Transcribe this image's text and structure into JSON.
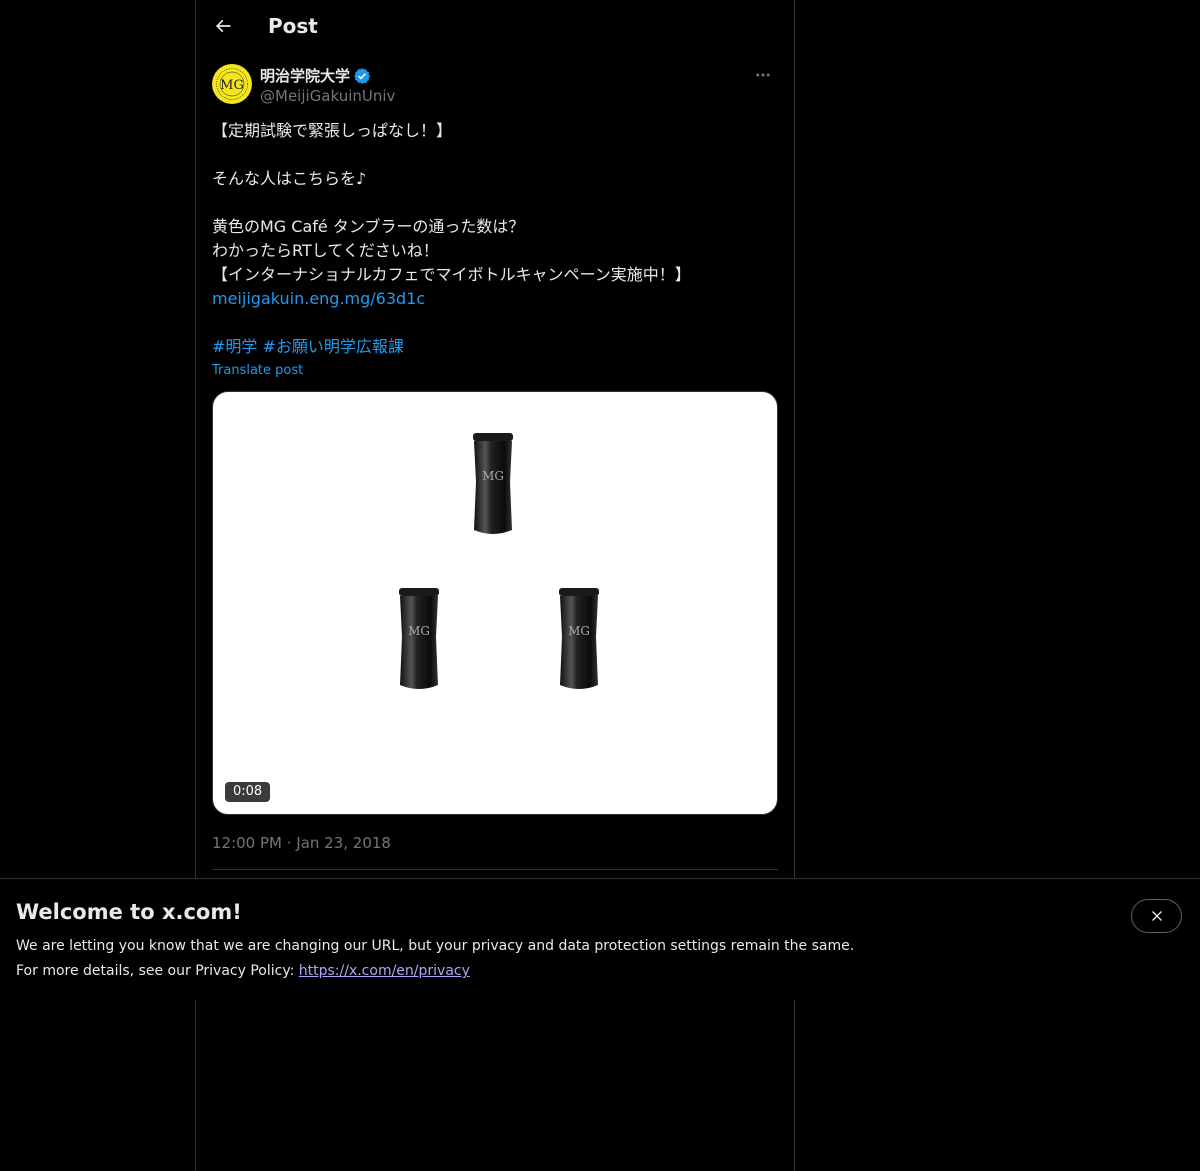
{
  "header": {
    "title": "Post"
  },
  "post": {
    "author": {
      "display_name": "明治学院大学",
      "handle": "@MeijiGakuinUniv",
      "avatar_initials": "MG",
      "verified": true
    },
    "text_lines": [
      "【定期試験で緊張しっぱなし！】",
      "",
      "そんな人はこちらを♪",
      "",
      "黄色のMG Café タンブラーの通った数は？",
      "わかったらRTしてくださいね！",
      "【インターナショナルカフェでマイボトルキャンペーン実施中！】"
    ],
    "link": "meijigakuin.eng.mg/63d1c",
    "hashtags": "#明学 #お願い明学広報課",
    "translate_label": "Translate post",
    "media": {
      "duration": "0:08",
      "tumbler_count": 3
    },
    "timestamp": "12:00 PM · Jan 23, 2018"
  },
  "banner": {
    "title": "Welcome to x.com!",
    "line1": "We are letting you know that we are changing our URL, but your privacy and data protection settings remain the same.",
    "line2_prefix": "For more details, see our Privacy Policy: ",
    "link": "https://x.com/en/privacy"
  },
  "colors": {
    "background": "#000000",
    "text": "#e7e9ea",
    "secondary_text": "#71767b",
    "link": "#1d9bf0",
    "verified_badge": "#1d9bf0",
    "avatar_bg": "#f5e51b",
    "border": "#2f3336"
  },
  "icons": {
    "back": "arrow-left-icon",
    "verified": "verified-badge-icon",
    "more": "more-horizontal-icon",
    "close": "close-icon"
  }
}
